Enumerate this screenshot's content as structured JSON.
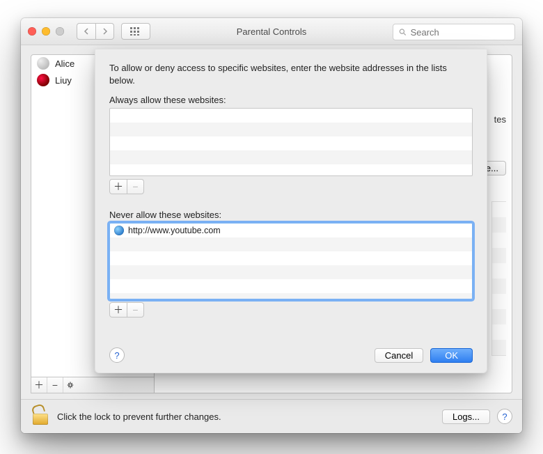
{
  "title": "Parental Controls",
  "search": {
    "placeholder": "Search"
  },
  "sidebar": {
    "users": [
      {
        "name": "Alice"
      },
      {
        "name": "Liuy"
      }
    ]
  },
  "rightPanel": {
    "peek_label_tes": "tes",
    "customize_button": "ze..."
  },
  "sheet": {
    "intro": "To allow or deny access to specific websites, enter the website addresses in the lists below.",
    "allow_label": "Always allow these websites:",
    "deny_label": "Never allow these websites:",
    "deny_items": [
      {
        "url": "http://www.youtube.com"
      }
    ],
    "cancel": "Cancel",
    "ok": "OK"
  },
  "footer": {
    "lock_text": "Click the lock to prevent further changes.",
    "logs_button": "Logs..."
  }
}
